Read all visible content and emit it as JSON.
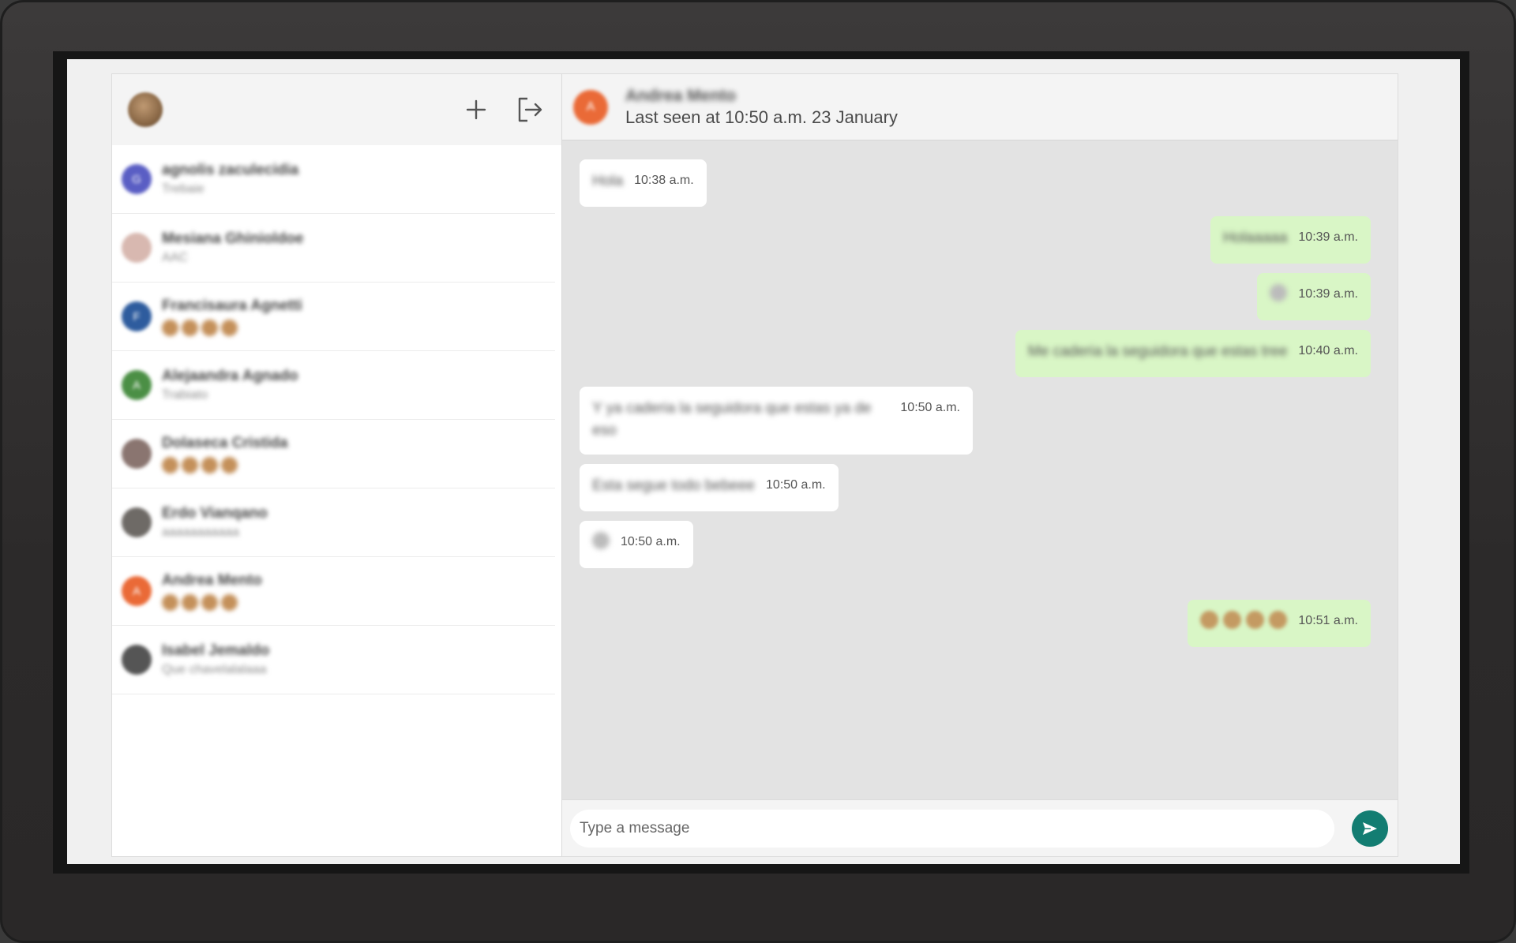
{
  "sidebar": {
    "icons": {
      "new_chat": "plus-icon",
      "logout": "logout-icon"
    },
    "chats": [
      {
        "name": "agnolis zaculecidia",
        "preview": "Trebaie",
        "avatar_letter": "G",
        "avatar_color": "#5a5ec4",
        "emoji_count": 0
      },
      {
        "name": "Mesiana Ghinioldoe",
        "preview": "AAC",
        "avatar_letter": "",
        "avatar_color": "#d8b8b0",
        "emoji_count": 0
      },
      {
        "name": "Francisaura Agnetti",
        "preview": "",
        "avatar_letter": "F",
        "avatar_color": "#2e5c9e",
        "emoji_count": 4
      },
      {
        "name": "Alejaandra Agnado",
        "preview": "Trabiato",
        "avatar_letter": "A",
        "avatar_color": "#4b8f45",
        "emoji_count": 0
      },
      {
        "name": "Dolaseca Cristida",
        "preview": "",
        "avatar_letter": "",
        "avatar_color": "#8a7570",
        "emoji_count": 4
      },
      {
        "name": "Erdo Vianqano",
        "preview": "aaaaaaaaaaa",
        "avatar_letter": "",
        "avatar_color": "#6e6a66",
        "emoji_count": 0
      },
      {
        "name": "Andrea Mento",
        "preview": "",
        "avatar_letter": "A",
        "avatar_color": "#ea6a37",
        "emoji_count": 4
      },
      {
        "name": "Isabel Jemaldo",
        "preview": "Que chavelalalaaa",
        "avatar_letter": "",
        "avatar_color": "#555555",
        "emoji_count": 0
      }
    ]
  },
  "conversation": {
    "contact_name": "Andrea Mento",
    "avatar_letter": "A",
    "status": "Last seen at 10:50 a.m. 23 January",
    "messages": [
      {
        "dir": "in",
        "text": "Hola",
        "time": "10:38 a.m."
      },
      {
        "dir": "out",
        "text": "Holaaaaa",
        "time": "10:39 a.m."
      },
      {
        "dir": "out",
        "text": "",
        "time": "10:39 a.m."
      },
      {
        "dir": "out",
        "text": "Me caderia la seguidora que estas tree",
        "time": "10:40 a.m."
      },
      {
        "dir": "in",
        "text": "Y ya caderia la seguidora que estas ya de eso",
        "time": "10:50 a.m."
      },
      {
        "dir": "in",
        "text": "Esta segue todo bebeee",
        "time": "10:50 a.m."
      },
      {
        "dir": "in",
        "text": "",
        "time": "10:50 a.m."
      },
      {
        "dir": "out",
        "text": "",
        "time": "10:51 a.m.",
        "emoji_count": 4
      }
    ]
  },
  "composer": {
    "placeholder": "Type a message",
    "send_icon": "send-icon"
  }
}
